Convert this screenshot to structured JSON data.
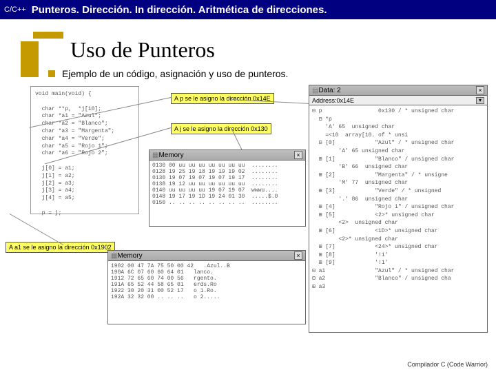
{
  "topbar": {
    "lang": "C/C++",
    "title": "Punteros. Dirección. In dirección. Aritmética de direcciones."
  },
  "slide_title": "Uso de Punteros",
  "subtitle": "Ejemplo de un código, asignación y uso de punteros.",
  "notes": {
    "p": "A p se le asigno la dirección 0x14E",
    "j": "A j se le asigno la dirección 0x130",
    "a1": "A a1 se le asigno la dirección 0x1902"
  },
  "code": "void main(void) {\n\n  char **p,  *j[10];\n  char *a1 = \"Azul\";\n  char *a2 = \"Blanco\";\n  char *a3 = \"Margenta\";\n  char *a4 = \"Verde\";\n  char *a5 = \"Rojo 1\";\n  char *a6 = \"Rojo 2\";\n\n  j[0] = a1;\n  j[1] = a2;\n  j[2] = a3;\n  j[3] = a4;\n  j[4] = a5;\n\n  p = j;",
  "mem1": {
    "title": "Memory",
    "lines": "0130 00 uu uu uu uu uu uu uu  ........\n0128 19 25 19 18 19 19 19 02  ........\n0130 19 07 19 07 19 07 19 17  ........\n0138 19 12 uu uu uu uu uu uu  ........\n0140 uu uu uu uu 19 07 19 07  wwwu....\n0148 19 17 19 1D 19 24 01 30  .....$.0\n0150 .. .. .. .. .. .. .. ..  ........"
  },
  "mem2": {
    "title": "Memory",
    "lines": "1902 00 47 7A 75 50 00 42   .Azul..B\n190A 6C 07 60 60 64 01   lanco.\n1912 72 65 60 74 00 56   rgento.\n191A 65 52 44 58 65 01   erds.Ro\n1922 30 20 31 00 52 17   o 1.Ro.\n192A 32 32 00 .. .. ..   o 2....."
  },
  "data": {
    "title": "Data: 2",
    "addr": "Address:0x14E",
    "lines": "⊟ p                 0x130 / * unsigned char\n  ⊟ *p\n    'A' 65  unsigned char\n    =<10  array[10. of * unsi\n  ⊟ [0]            \"Azul\" / * unsigned char\n        'A' 65 unsigned char\n  ⊞ [1]            \"Blanco\" / unsigned char\n        'B' 66  unsigned char\n  ⊞ [2]            \"Margenta\" / * unsigne\n        'M' 77  unsigned char\n  ⊞ [3]            \"Verde\" / * unsigned\n        '.' 86  unsigned char\n  ⊞ [4]            \"Rojo 1\" / unsigned char\n  ⊞ [5]            <2>* unsigned char\n        <2>  unsigned char\n  ⊞ [6]            <1D>* unsigned char\n        <2>* unsigned char\n  ⊞ [7]            <24>* unsigned char\n  ⊞ [8]            '!1'\n  ⊞ [9]            '!1'\n⊟ a1               \"Azul\" / * unsigned char\n⊟ a2               \"Blanco\" / unsigned cha\n⊞ a3"
  },
  "footer": "Compilador C (Code Warrior)"
}
